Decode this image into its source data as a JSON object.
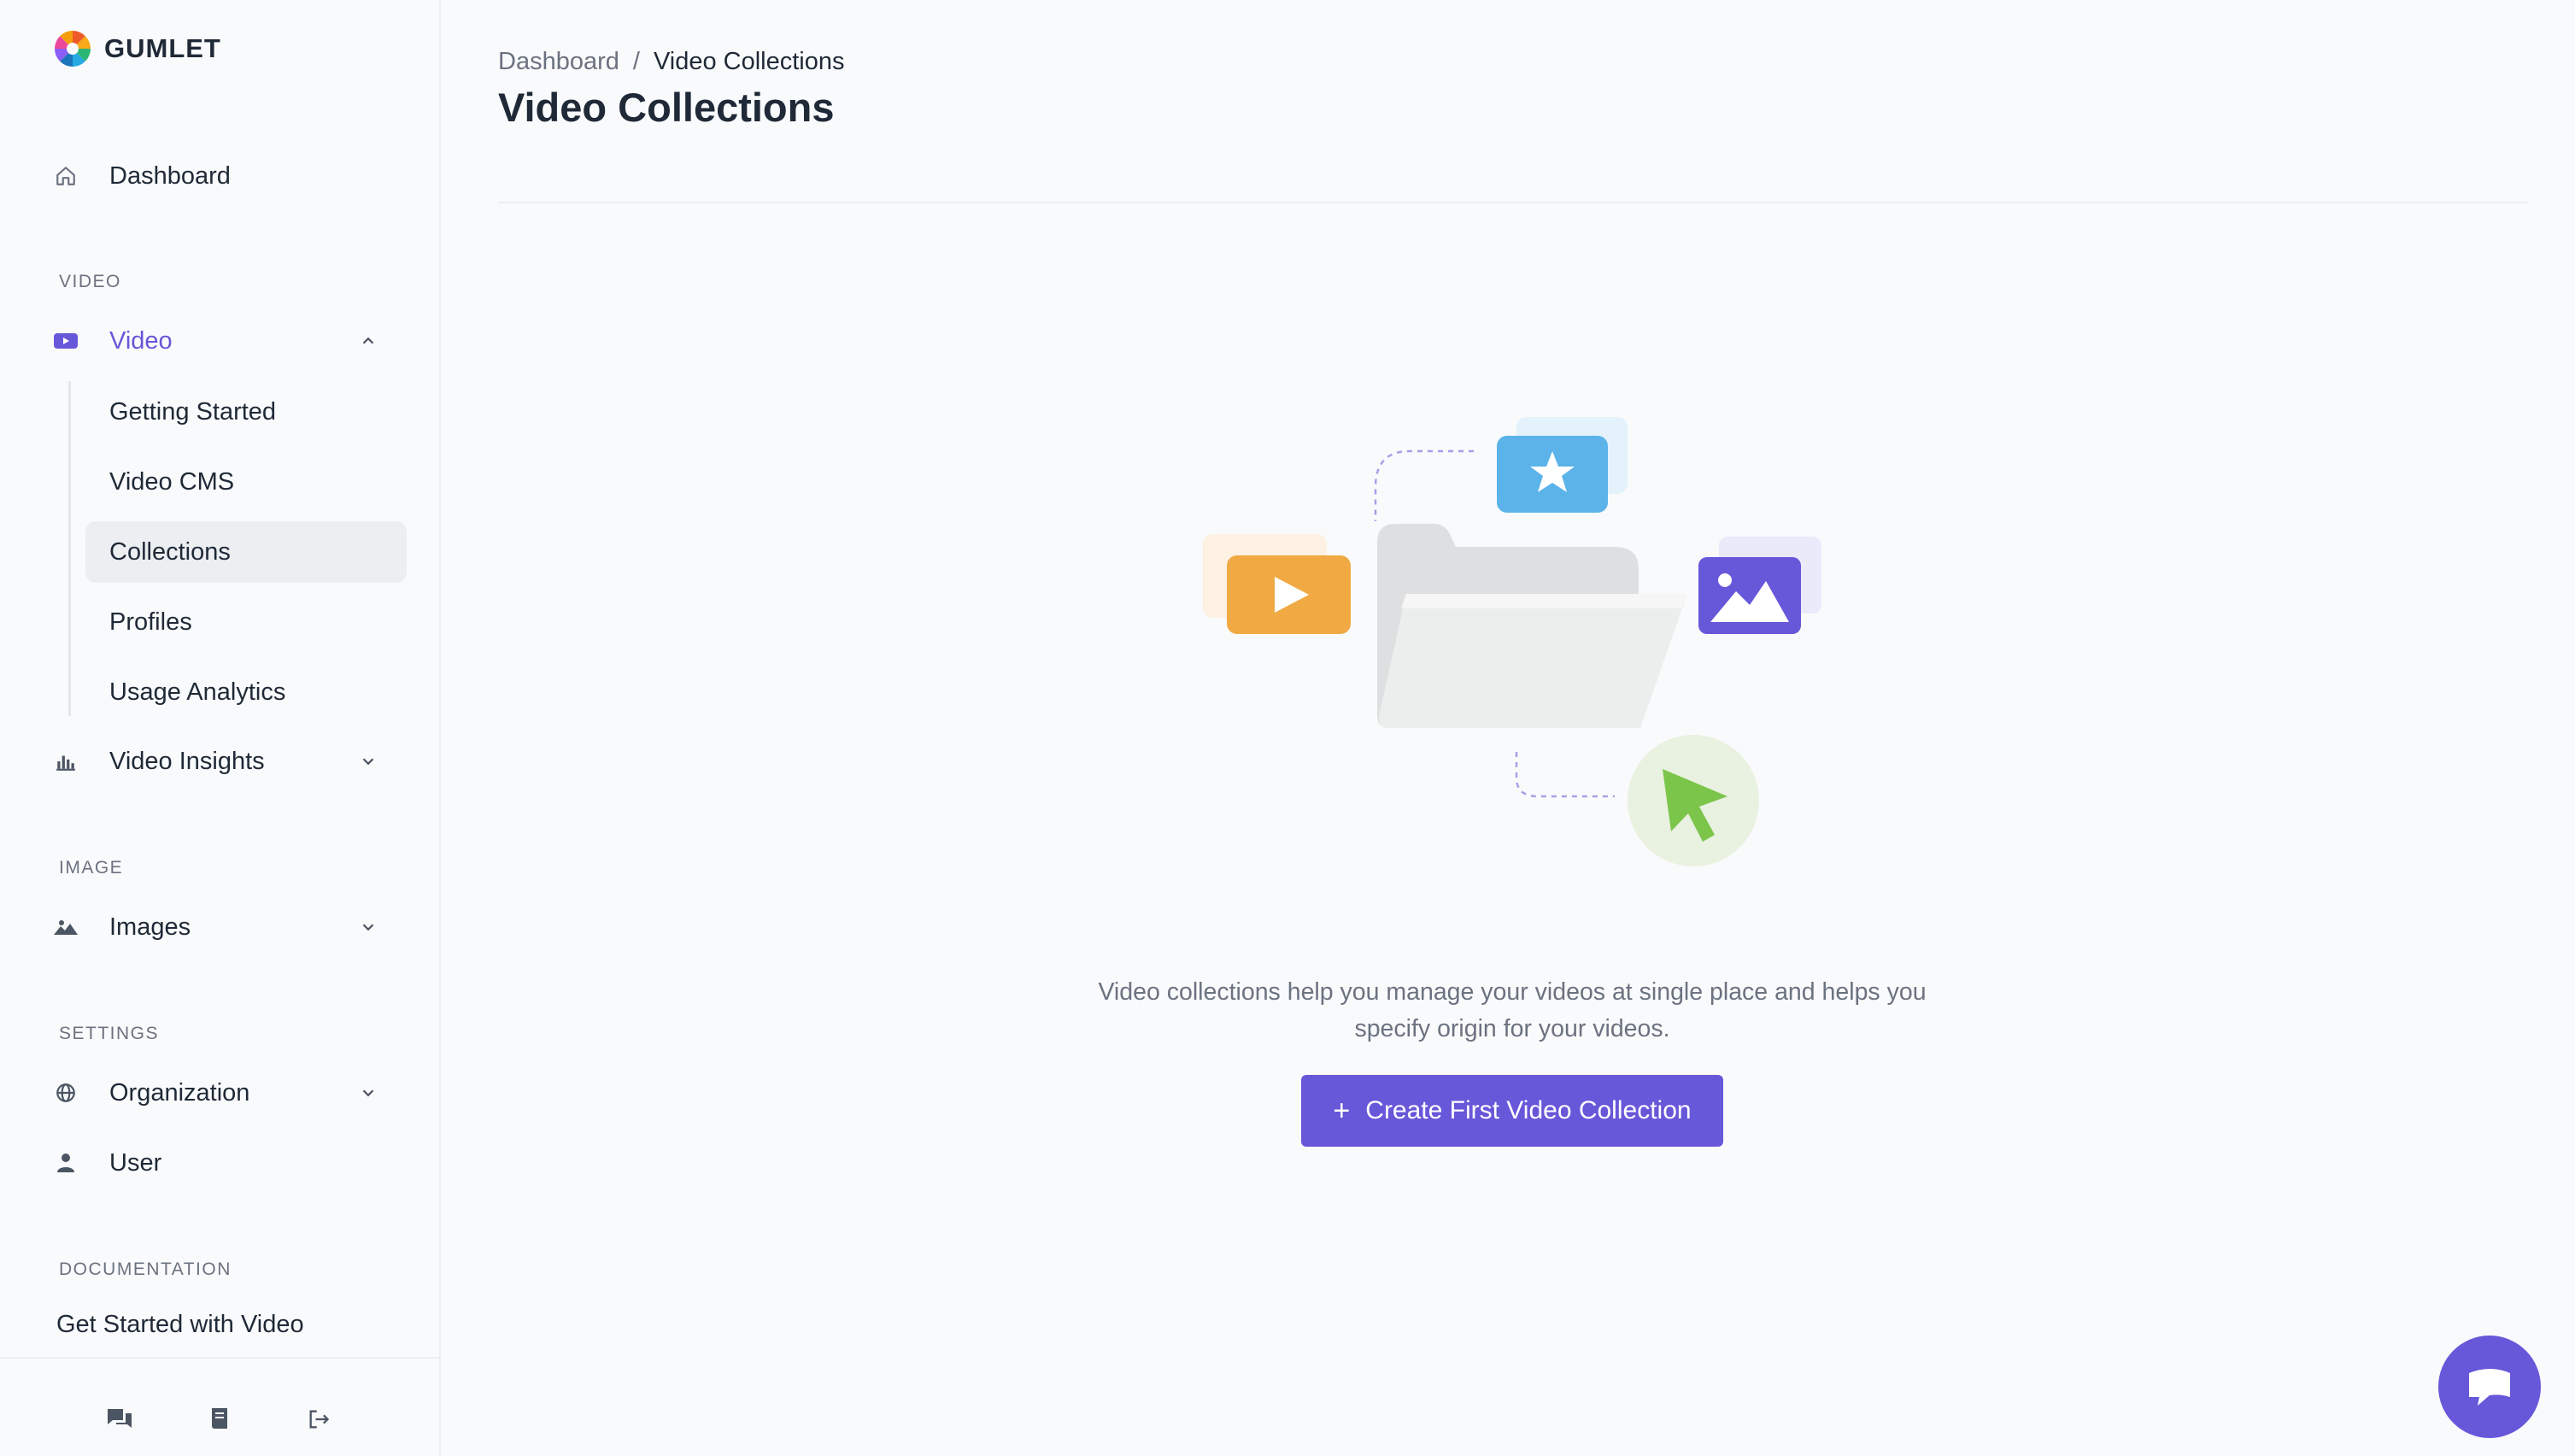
{
  "app": {
    "logo_text": "GUMLET"
  },
  "sidebar": {
    "dashboard": {
      "label": "Dashboard",
      "icon": "home-icon"
    },
    "sections": {
      "video": "VIDEO",
      "image": "IMAGE",
      "settings": "SETTINGS",
      "documentation": "DOCUMENTATION"
    },
    "video": {
      "label": "Video",
      "icon": "video-play-icon",
      "expanded": true,
      "children": [
        {
          "label": "Getting Started"
        },
        {
          "label": "Video CMS"
        },
        {
          "label": "Collections",
          "selected": true
        },
        {
          "label": "Profiles"
        },
        {
          "label": "Usage Analytics"
        }
      ]
    },
    "video_insights": {
      "label": "Video Insights",
      "icon": "bar-chart-icon"
    },
    "images": {
      "label": "Images",
      "icon": "mountain-image-icon"
    },
    "organization": {
      "label": "Organization",
      "icon": "globe-icon"
    },
    "user": {
      "label": "User",
      "icon": "user-icon"
    },
    "docs_link": "Get Started with Video",
    "footer_icons": [
      "chat-bubbles-icon",
      "book-icon",
      "logout-icon"
    ]
  },
  "breadcrumb": {
    "parent": "Dashboard",
    "separator": "/",
    "current": "Video Collections"
  },
  "page": {
    "title": "Video Collections"
  },
  "empty_state": {
    "description": "Video collections help you manage your videos at single place and helps you specify origin for your videos.",
    "button_label": "Create First Video Collection"
  },
  "colors": {
    "accent": "#6757d9",
    "background": "#f9fafb",
    "selected_bg": "#eceef2",
    "text": "#1f2937",
    "muted": "#6b7280"
  }
}
